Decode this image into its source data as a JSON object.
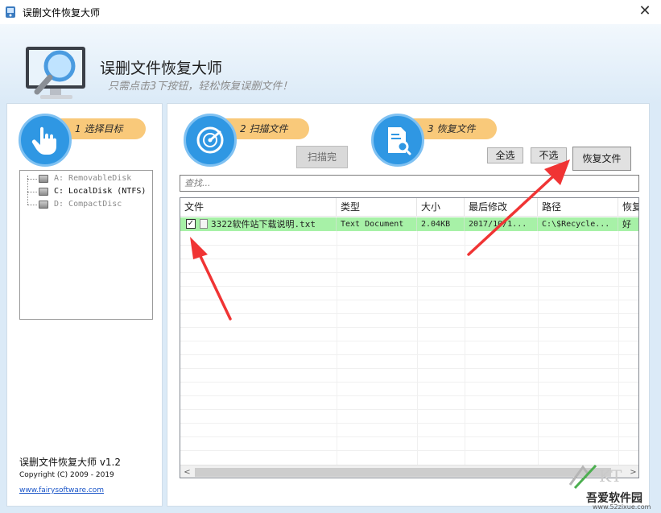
{
  "window": {
    "title": "误删文件恢复大师",
    "close_symbol": "✕"
  },
  "header": {
    "app_title": "误删文件恢复大师",
    "subtitle": "只需点击3下按钮，轻松恢复误删文件！"
  },
  "steps": [
    {
      "label": "1 选择目标",
      "icon": "hand-pointer-icon"
    },
    {
      "label": "2 扫描文件",
      "icon": "radar-scan-icon"
    },
    {
      "label": "3 恢复文件",
      "icon": "document-search-icon"
    }
  ],
  "tree": {
    "drives": [
      {
        "label": "A: RemovableDisk",
        "state": "disabled"
      },
      {
        "label": "C: LocalDisk (NTFS)",
        "state": "enabled"
      },
      {
        "label": "D: CompactDisc",
        "state": "disabled"
      }
    ]
  },
  "about": {
    "version": "误删文件恢复大师 v1.2",
    "copyright": "Copyright (C) 2009 - 2019",
    "website": "www.fairysoftware.com"
  },
  "buttons": {
    "scan_done": "扫描完",
    "select_all": "全选",
    "select_none": "不选",
    "recover": "恢复文件"
  },
  "search": {
    "placeholder": "查找..."
  },
  "table": {
    "columns": [
      "文件",
      "类型",
      "大小",
      "最后修改",
      "路径",
      "恢复"
    ],
    "rows": [
      {
        "checked": true,
        "name": "3322软件站下载说明.txt",
        "type": "Text Document",
        "size": "2.04KB",
        "modified": "2017/10/1...",
        "path": "C:\\$Recycle...",
        "recover": "好"
      }
    ],
    "check_mark": "✓"
  },
  "scrollbar": {
    "left_arrow": "<",
    "right_arrow": ">"
  },
  "watermark": {
    "brand": "吾爱软件园",
    "url": "www.52zixue.com"
  },
  "colors": {
    "accent_blue": "#2f97e3",
    "step_pill": "#f9c97a",
    "row_highlight": "#a7f1a7",
    "arrow_red": "#f03434"
  }
}
